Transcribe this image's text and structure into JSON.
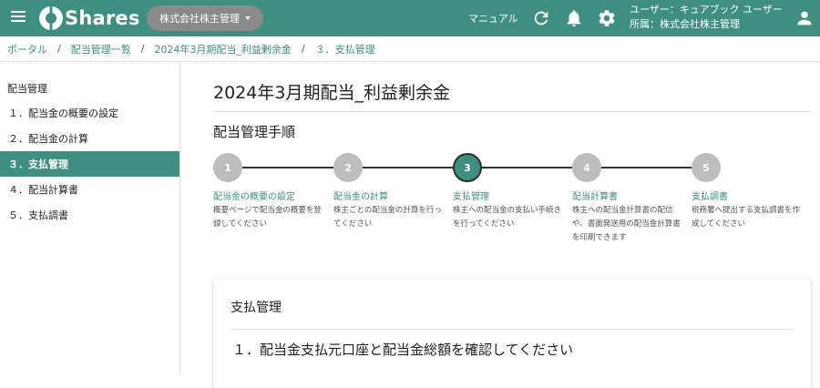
{
  "header": {
    "app_name": "Shares",
    "company_button": "株式会社株主管理",
    "manual_link": "マニュアル",
    "user_line": "ユーザー：キュアブック ユーザー",
    "org_line": "所属：株式会社株主管理",
    "accent_color": "#3f8f80",
    "icons": [
      "menu-icon",
      "refresh-icon",
      "bell-icon",
      "gear-icon",
      "person-icon"
    ]
  },
  "breadcrumb": {
    "items": [
      "ポータル",
      "配当管理一覧",
      "2024年3月期配当_利益剰余金",
      "３．支払管理"
    ],
    "separator": "/"
  },
  "sidebar": {
    "title": "配当管理",
    "items": [
      {
        "label": "１．配当金の概要の設定",
        "active": false
      },
      {
        "label": "２．配当金の計算",
        "active": false
      },
      {
        "label": "３．支払管理",
        "active": true
      },
      {
        "label": "４．配当計算書",
        "active": false
      },
      {
        "label": "５．支払調書",
        "active": false
      }
    ]
  },
  "main": {
    "page_title": "2024年3月期配当_利益剰余金",
    "section_title": "配当管理手順",
    "steps": [
      {
        "number": "1",
        "label": "配当金の概要の設定",
        "desc": "概要ページで配当金の概要を登録してください",
        "active": false
      },
      {
        "number": "2",
        "label": "配当金の計算",
        "desc": "株主ごとの配当金の計算を行ってください",
        "active": false
      },
      {
        "number": "3",
        "label": "支払管理",
        "desc": "株主への配当金の支払い手続きを行ってください",
        "active": true
      },
      {
        "number": "4",
        "label": "配当計算書",
        "desc": "株主への配当金計算書の配信や、書面発送用の配当金計算書を印刷できます",
        "active": false
      },
      {
        "number": "5",
        "label": "支払調書",
        "desc": "税務署へ提出する支払調書を作成してください",
        "active": false
      }
    ],
    "card": {
      "title": "支払管理",
      "heading": "１．配当金支払元口座と配当金総額を確認してください"
    }
  }
}
